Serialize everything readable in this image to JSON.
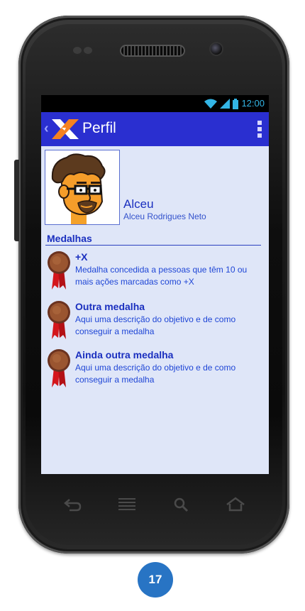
{
  "status_bar": {
    "time": "12:00"
  },
  "app_bar": {
    "title": "Perfil"
  },
  "profile": {
    "name": "Alceu",
    "full_name": "Alceu Rodrigues Neto"
  },
  "medals_section": {
    "title": "Medalhas",
    "items": [
      {
        "title": "+X",
        "description": "Medalha concedida a pessoas que têm 10 ou mais ações marcadas como +X"
      },
      {
        "title": "Outra medalha",
        "description": "Aqui uma descrição do objetivo e de como conseguir a medalha"
      },
      {
        "title": "Ainda outra medalha",
        "description": "Aqui uma descrição do objetivo e de como conseguir a medalha"
      }
    ]
  },
  "page_badge": "17",
  "colors": {
    "app_bar": "#2a2fd0",
    "screen_bg": "#dfe6f8",
    "text_blue": "#1a2fbf",
    "badge": "#2874c4",
    "medal_bronze": "#8b4a2b",
    "ribbon_red": "#d4161c"
  },
  "icons": {
    "wifi": "wifi-icon",
    "signal": "signal-icon",
    "battery": "battery-icon",
    "back": "back-icon",
    "home": "home-icon",
    "menu": "menu-icon",
    "search": "search-icon"
  }
}
